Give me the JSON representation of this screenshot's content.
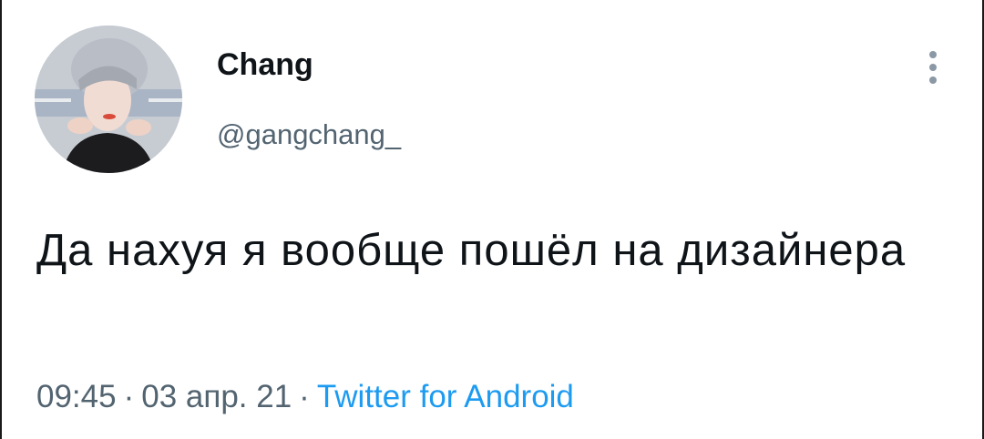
{
  "author": {
    "display_name": "Chang",
    "handle": "@gangchang_",
    "avatar_icon": "profile-photo"
  },
  "tweet": {
    "text": "Да нахуя я вообще пошёл на дизайнера"
  },
  "meta": {
    "time": "09:45",
    "separator": "·",
    "date": "03 апр. 21",
    "source": "Twitter for Android"
  },
  "menu": {
    "icon": "more-vertical-icon"
  },
  "colors": {
    "text_primary": "#0f1419",
    "text_secondary": "#536471",
    "link": "#1d9bf0",
    "icon": "#8b98a5"
  }
}
